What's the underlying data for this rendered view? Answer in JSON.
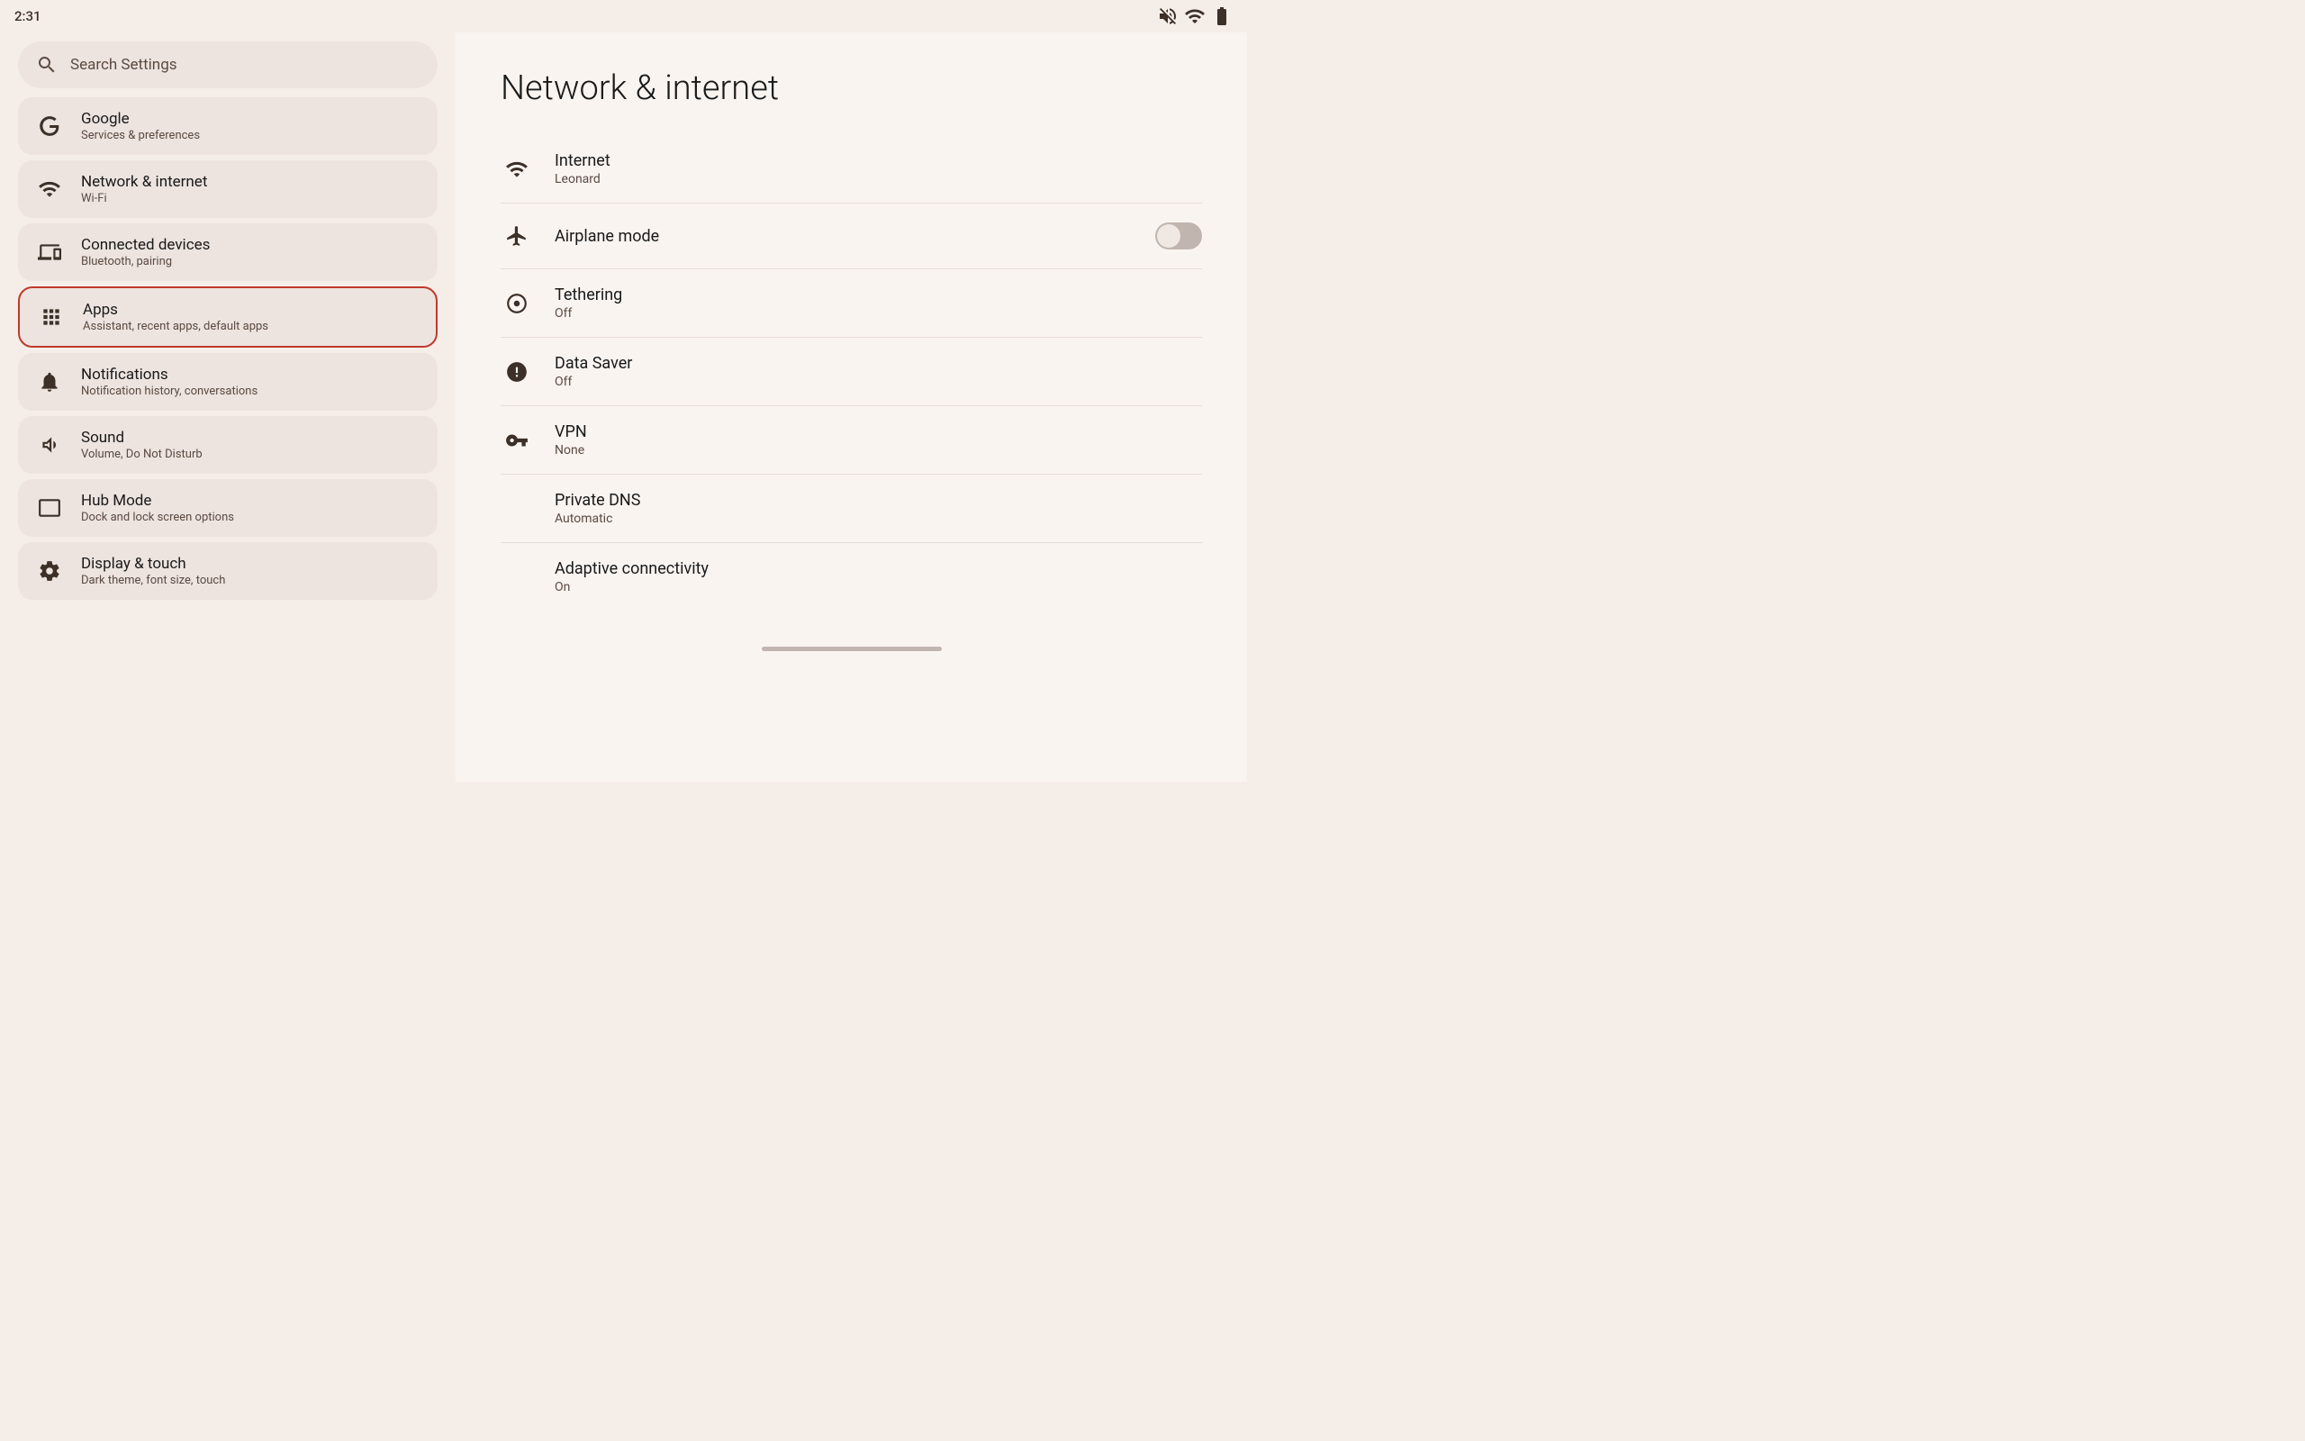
{
  "statusBar": {
    "time": "2:31",
    "icons": [
      "mute",
      "wifi",
      "battery"
    ]
  },
  "sidebar": {
    "searchPlaceholder": "Search Settings",
    "items": [
      {
        "id": "google",
        "title": "Google",
        "subtitle": "Services & preferences",
        "icon": "google",
        "active": false
      },
      {
        "id": "network",
        "title": "Network & internet",
        "subtitle": "Wi-Fi",
        "icon": "wifi",
        "active": false
      },
      {
        "id": "connected-devices",
        "title": "Connected devices",
        "subtitle": "Bluetooth, pairing",
        "icon": "devices",
        "active": false
      },
      {
        "id": "apps",
        "title": "Apps",
        "subtitle": "Assistant, recent apps, default apps",
        "icon": "apps",
        "active": true
      },
      {
        "id": "notifications",
        "title": "Notifications",
        "subtitle": "Notification history, conversations",
        "icon": "notifications",
        "active": false
      },
      {
        "id": "sound",
        "title": "Sound",
        "subtitle": "Volume, Do Not Disturb",
        "icon": "sound",
        "active": false
      },
      {
        "id": "hub-mode",
        "title": "Hub Mode",
        "subtitle": "Dock and lock screen options",
        "icon": "hub",
        "active": false
      },
      {
        "id": "display",
        "title": "Display & touch",
        "subtitle": "Dark theme, font size, touch",
        "icon": "display",
        "active": false
      }
    ]
  },
  "content": {
    "title": "Network & internet",
    "items": [
      {
        "id": "internet",
        "title": "Internet",
        "subtitle": "Leonard",
        "icon": "wifi",
        "hasToggle": false
      },
      {
        "id": "airplane",
        "title": "Airplane mode",
        "subtitle": "",
        "icon": "airplane",
        "hasToggle": true,
        "toggleOn": false
      },
      {
        "id": "tethering",
        "title": "Tethering",
        "subtitle": "Off",
        "icon": "tethering",
        "hasToggle": false
      },
      {
        "id": "data-saver",
        "title": "Data Saver",
        "subtitle": "Off",
        "icon": "data-saver",
        "hasToggle": false
      },
      {
        "id": "vpn",
        "title": "VPN",
        "subtitle": "None",
        "icon": "vpn",
        "hasToggle": false
      },
      {
        "id": "private-dns",
        "title": "Private DNS",
        "subtitle": "Automatic",
        "icon": null,
        "hasToggle": false
      },
      {
        "id": "adaptive-connectivity",
        "title": "Adaptive connectivity",
        "subtitle": "On",
        "icon": null,
        "hasToggle": false
      }
    ]
  }
}
